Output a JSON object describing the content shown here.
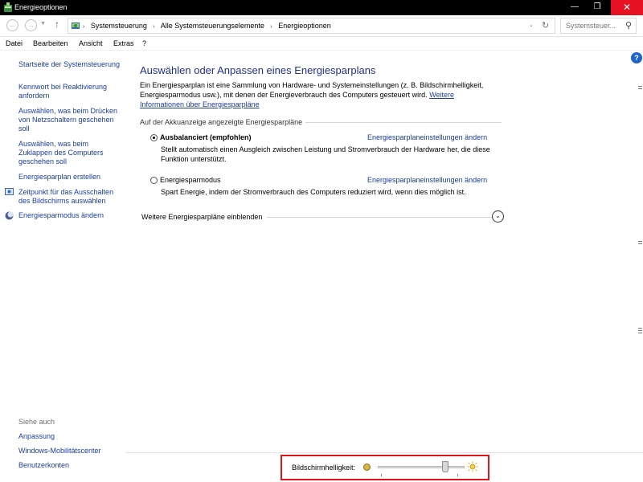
{
  "window": {
    "title": "Energieoptionen",
    "minimize_glyph": "—",
    "maximize_glyph": "❐",
    "close_glyph": "✕"
  },
  "address": {
    "crumbs": [
      "Systemsteuerung",
      "Alle Systemsteuerungselemente",
      "Energieoptionen"
    ],
    "separator": "›",
    "search_placeholder": "Systemsteuer..."
  },
  "menu": [
    "Datei",
    "Bearbeiten",
    "Ansicht",
    "Extras",
    "?"
  ],
  "sidebar": {
    "links": [
      "Startseite der Systemsteuerung",
      "Kennwort bei Reaktivierung anfordern",
      "Auswählen, was beim Drücken von Netzschaltern geschehen soll",
      "Auswählen, was beim Zuklappen des Computers geschehen soll",
      "Energiesparplan erstellen",
      "Zeitpunkt für das Ausschalten des Bildschirms auswählen",
      "Energiesparmodus ändern"
    ],
    "see_also_label": "Siehe auch",
    "see_also": [
      "Anpassung",
      "Windows-Mobilitätscenter",
      "Benutzerkonten"
    ]
  },
  "main": {
    "heading": "Auswählen oder Anpassen eines Energiesparplans",
    "intro": "Ein Energiesparplan ist eine Sammlung von Hardware- und Systemeinstellungen (z. B. Bildschirmhelligkeit, Energiesparmodus usw.), mit denen der Energieverbrauch des Computers gesteuert wird.",
    "intro_link": "Weitere Informationen über Energiesparpläne",
    "group_label": "Auf der Akkuanzeige angezeigte Energiesparpläne",
    "plans": [
      {
        "name": "Ausbalanciert (empfohlen)",
        "selected": true,
        "link": "Energiesparplaneinstellungen ändern",
        "description": "Stellt automatisch einen Ausgleich zwischen Leistung und Stromverbrauch der Hardware her, die diese Funktion unterstützt."
      },
      {
        "name": "Energiesparmodus",
        "selected": false,
        "link": "Energiesparplaneinstellungen ändern",
        "description": "Spart Energie, indem der Stromverbrauch des Computers reduziert wird, wenn dies möglich ist."
      }
    ],
    "more_plans": "Weitere Energiesparpläne einblenden",
    "expand_glyph": "⌄"
  },
  "help_glyph": "?",
  "brightness": {
    "label": "Bildschirmhelligkeit:",
    "value_percent": 80,
    "highlight_color": "#e0151b"
  }
}
